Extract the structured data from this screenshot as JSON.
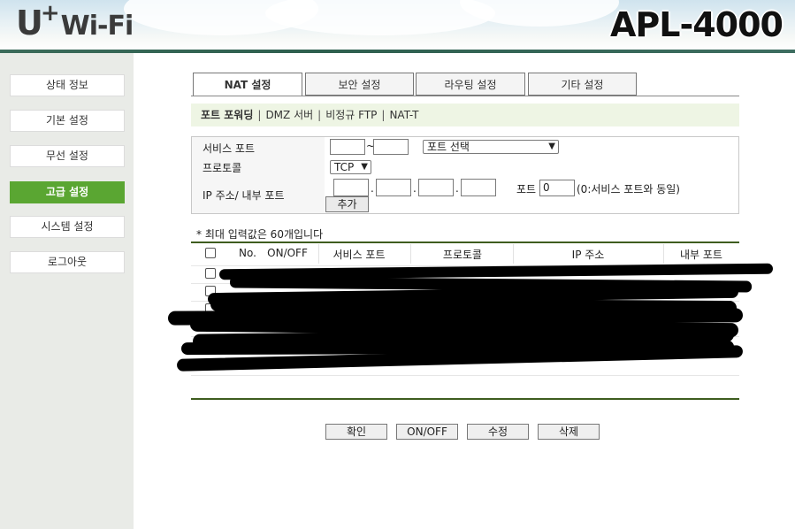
{
  "header": {
    "logo_u": "U",
    "logo_plus": "+",
    "logo_wifi": "Wi-Fi",
    "model": "APL-4000"
  },
  "sidebar": {
    "items": [
      {
        "label": "상태 정보"
      },
      {
        "label": "기본 설정"
      },
      {
        "label": "무선 설정"
      },
      {
        "label": "고급 설정",
        "active": true
      },
      {
        "label": "시스템 설정"
      },
      {
        "label": "로그아웃"
      }
    ]
  },
  "tabs": [
    {
      "label": "NAT 설정",
      "active": true
    },
    {
      "label": "보안 설정"
    },
    {
      "label": "라우팅 설정"
    },
    {
      "label": "기타 설정"
    }
  ],
  "subnav": {
    "current": "포트 포워딩",
    "items": [
      "DMZ 서버",
      "비정규 FTP",
      "NAT-T"
    ]
  },
  "form": {
    "service_port_label": "서비스 포트",
    "tilde": "~",
    "port_select": "포트 선택",
    "protocol_label": "프로토콜",
    "protocol_value": "TCP",
    "ip_label": "IP 주소/ 내부 포트",
    "dot": ".",
    "port_label": "포트",
    "port_value": "0",
    "port_hint": "(0:서비스 포트와 동일)",
    "add_button": "추가"
  },
  "table": {
    "note": "* 최대 입력값은 60개입니다",
    "headers": [
      "No.",
      "ON/OFF",
      "서비스 포트",
      "프로토콜",
      "IP 주소",
      "내부 포트"
    ]
  },
  "buttons": {
    "confirm": "확인",
    "onoff": "ON/OFF",
    "edit": "수정",
    "delete": "삭제"
  },
  "colors": {
    "accent": "#5aa632",
    "header_bar": "#2d5f4e",
    "table_rule": "#3e5d1f"
  }
}
